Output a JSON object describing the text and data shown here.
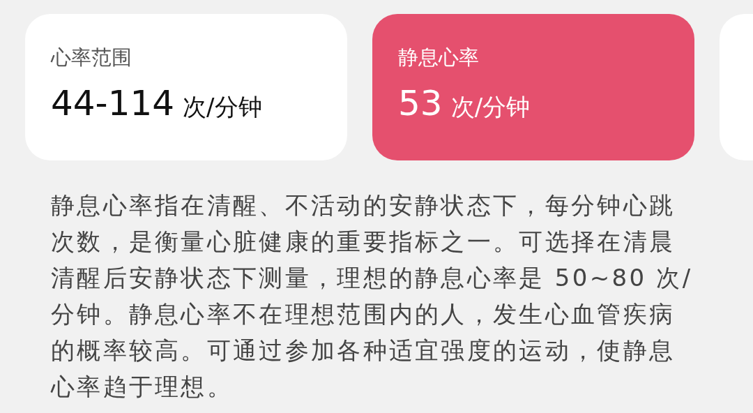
{
  "cards": [
    {
      "title": "心率范围",
      "value": "44-114",
      "unit": "次/分钟",
      "selected": false
    },
    {
      "title": "静息心率",
      "value": "53",
      "unit": "次/分钟",
      "selected": true
    }
  ],
  "partial_card": true,
  "description": "静息心率指在清醒、不活动的安静状态下，每分钟心跳次数，是衡量心脏健康的重要指标之一。可选择在清晨清醒后安静状态下测量，理想的静息心率是 50~80 次/分钟。静息心率不在理想范围内的人，发生心血管疾病的概率较高。可通过参加各种适宜强度的运动，使静息心率趋于理想。"
}
